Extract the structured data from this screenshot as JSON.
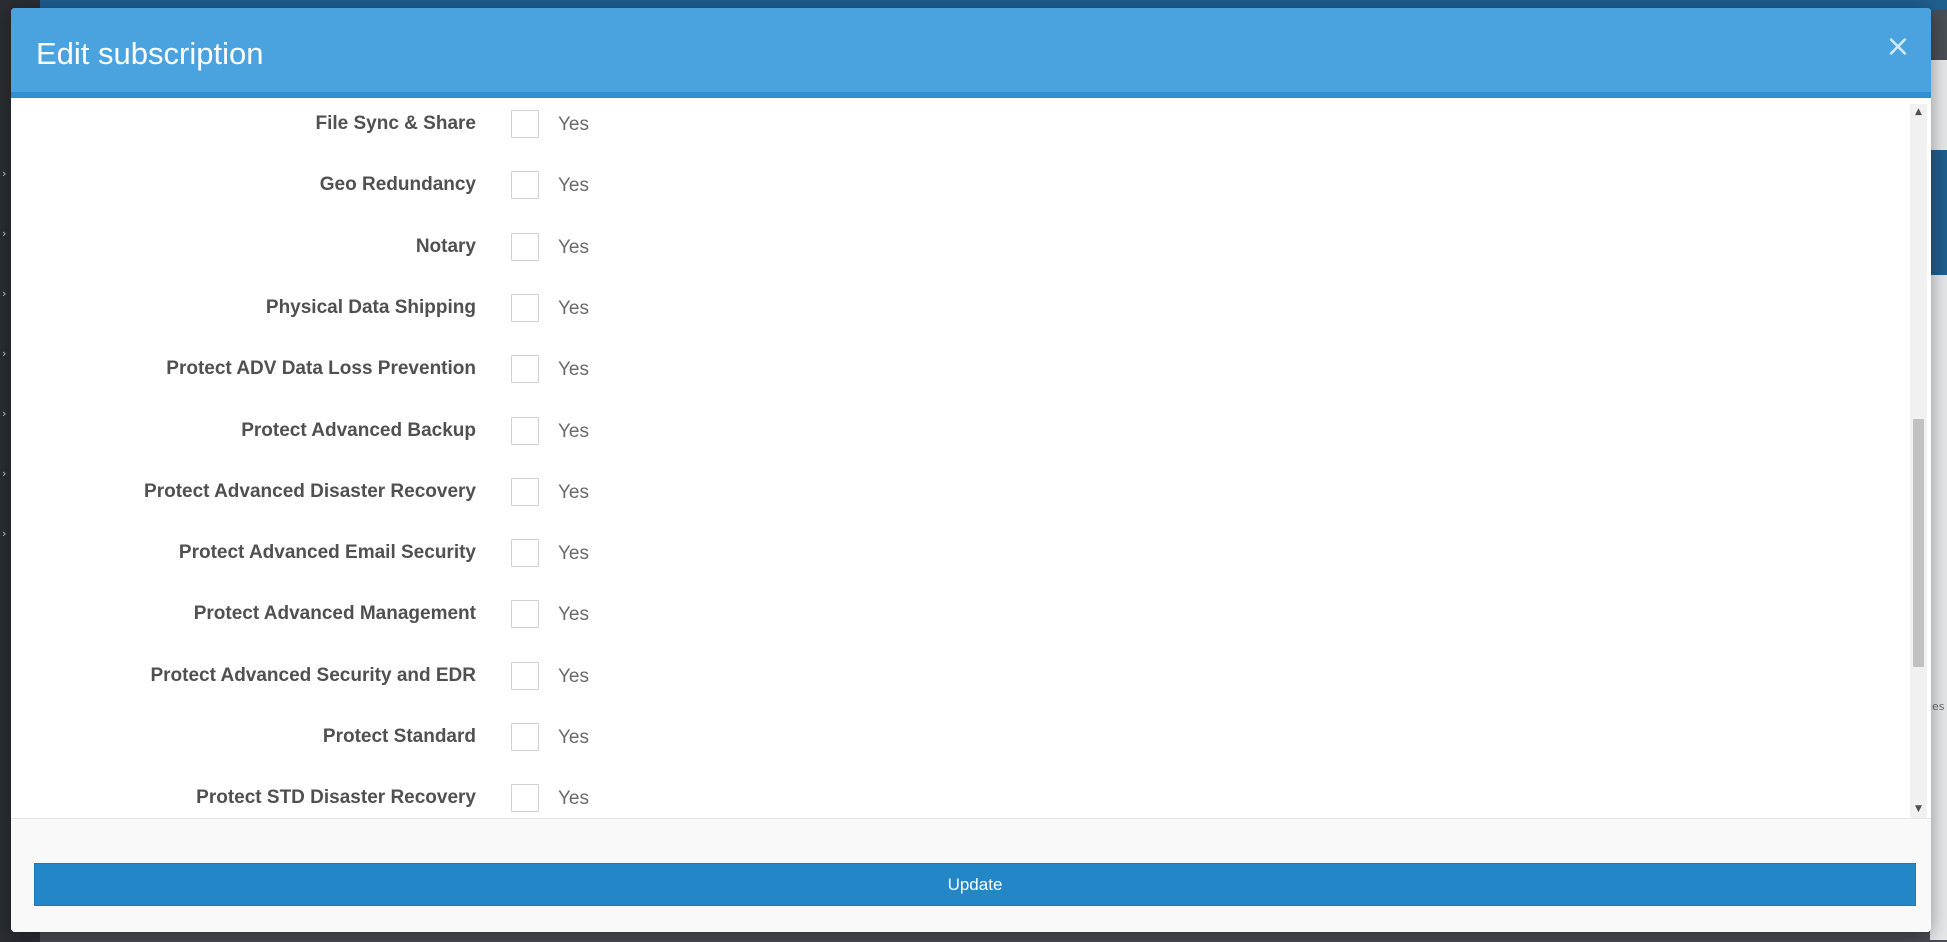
{
  "modal": {
    "title": "Edit subscription",
    "close_label": "×"
  },
  "options": [
    {
      "label": "File Sync & Share",
      "value_label": "Yes",
      "checked": false
    },
    {
      "label": "Geo Redundancy",
      "value_label": "Yes",
      "checked": false
    },
    {
      "label": "Notary",
      "value_label": "Yes",
      "checked": false
    },
    {
      "label": "Physical Data Shipping",
      "value_label": "Yes",
      "checked": false
    },
    {
      "label": "Protect ADV Data Loss Prevention",
      "value_label": "Yes",
      "checked": false
    },
    {
      "label": "Protect Advanced Backup",
      "value_label": "Yes",
      "checked": false
    },
    {
      "label": "Protect Advanced Disaster Recovery",
      "value_label": "Yes",
      "checked": false
    },
    {
      "label": "Protect Advanced Email Security",
      "value_label": "Yes",
      "checked": false
    },
    {
      "label": "Protect Advanced Management",
      "value_label": "Yes",
      "checked": false
    },
    {
      "label": "Protect Advanced Security and EDR",
      "value_label": "Yes",
      "checked": false
    },
    {
      "label": "Protect Standard",
      "value_label": "Yes",
      "checked": false
    },
    {
      "label": "Protect STD Disaster Recovery",
      "value_label": "Yes",
      "checked": false
    }
  ],
  "scrollbar": {
    "up_icon": "▲",
    "down_icon": "▼"
  },
  "footer": {
    "update_label": "Update"
  },
  "background": {
    "partial_text": "es"
  },
  "colors": {
    "header": "#4aa3df",
    "header_border": "#2f8fd0",
    "button": "#2387c7"
  }
}
